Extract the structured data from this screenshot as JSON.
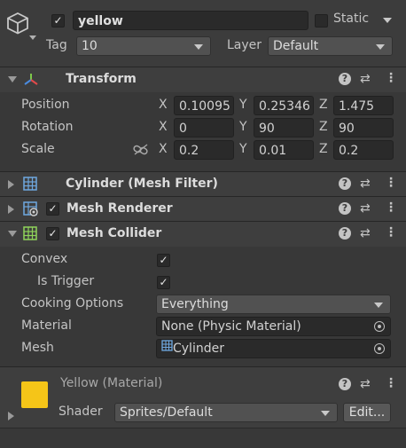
{
  "object": {
    "name": "yellow",
    "static_label": "Static",
    "active": true,
    "is_static": false,
    "tag_label": "Tag",
    "tag_value": "10",
    "layer_label": "Layer",
    "layer_value": "Default"
  },
  "transform": {
    "title": "Transform",
    "rows": [
      {
        "label": "Position",
        "x": "0.10095",
        "y": "0.25346",
        "z": "1.475"
      },
      {
        "label": "Rotation",
        "x": "0",
        "y": "90",
        "z": "90"
      },
      {
        "label": "Scale",
        "x": "0.2",
        "y": "0.01",
        "z": "0.2"
      }
    ],
    "axis_x": "X",
    "axis_y": "Y",
    "axis_z": "Z"
  },
  "mesh_filter": {
    "title": "Cylinder (Mesh Filter)"
  },
  "mesh_renderer": {
    "title": "Mesh Renderer",
    "enabled": true
  },
  "mesh_collider": {
    "title": "Mesh Collider",
    "enabled": true,
    "convex_label": "Convex",
    "convex": true,
    "trigger_label": "Is Trigger",
    "trigger": true,
    "cooking_label": "Cooking Options",
    "cooking_value": "Everything",
    "material_label": "Material",
    "material_value": "None (Physic Material)",
    "mesh_label": "Mesh",
    "mesh_value": "Cylinder"
  },
  "material": {
    "title": "Yellow (Material)",
    "swatch_color": "#f5c518",
    "shader_label": "Shader",
    "shader_value": "Sprites/Default",
    "edit_label": "Edit..."
  },
  "icons": {
    "help": "?",
    "preset": "⇄",
    "menu": "⋮",
    "check": "✓"
  }
}
